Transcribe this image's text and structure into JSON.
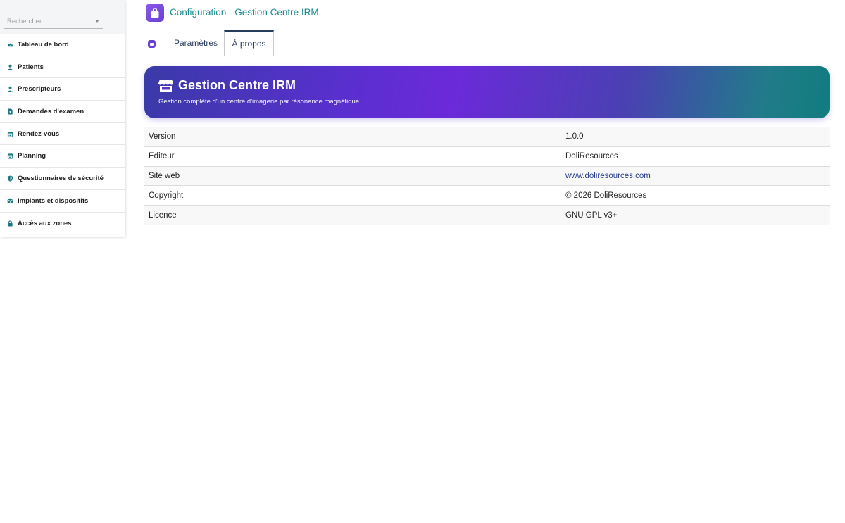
{
  "sidebar": {
    "search_placeholder": "Rechercher",
    "items": [
      {
        "label": "Tableau de bord",
        "icon": "dashboard-icon"
      },
      {
        "label": "Patients",
        "icon": "user-icon"
      },
      {
        "label": "Prescripteurs",
        "icon": "user-doctor-icon"
      },
      {
        "label": "Demandes d'examen",
        "icon": "file-medical-icon"
      },
      {
        "label": "Rendez-vous",
        "icon": "calendar-icon"
      },
      {
        "label": "Planning",
        "icon": "calendar-check-icon"
      },
      {
        "label": "Questionnaires de sécurité",
        "icon": "shield-icon"
      },
      {
        "label": "Implants et dispositifs",
        "icon": "cube-icon"
      },
      {
        "label": "Accès aux zones",
        "icon": "lock-icon"
      }
    ]
  },
  "header": {
    "title": "Configuration - Gestion Centre IRM"
  },
  "tabs": [
    {
      "label": "Paramètres",
      "active": false
    },
    {
      "label": "À propos",
      "active": true
    }
  ],
  "banner": {
    "title": "Gestion Centre IRM",
    "subtitle": "Gestion complète d'un centre d'imagerie par résonance magnétique"
  },
  "info": [
    {
      "key": "Version",
      "value": "1.0.0"
    },
    {
      "key": "Editeur",
      "value": "DoliResources"
    },
    {
      "key": "Site web",
      "value": "www.doliresources.com"
    },
    {
      "key": "Copyright",
      "value": "© 2026 DoliResources"
    },
    {
      "key": "Licence",
      "value": "GNU GPL v3+"
    }
  ],
  "colors": {
    "accent_teal": "#1c8a8e",
    "icon_teal": "#1b7a80",
    "tab_text": "#263c5c",
    "banner_start": "#3a3aa8",
    "banner_mid": "#6b2ad9",
    "banner_end": "#117c7e"
  }
}
